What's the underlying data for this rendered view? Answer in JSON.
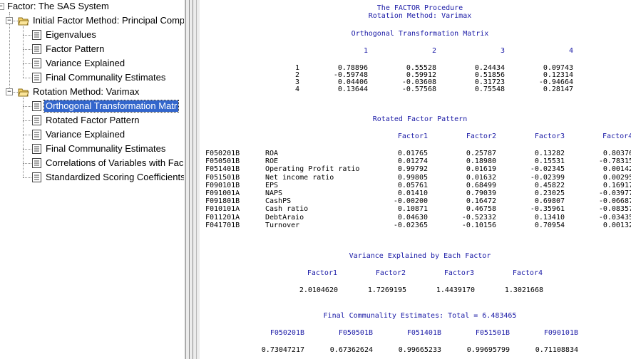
{
  "tree": {
    "root": "Factor:  The SAS System",
    "groups": [
      {
        "label": "Initial Factor Method: Principal Comp",
        "items": [
          "Eigenvalues",
          "Factor Pattern",
          "Variance Explained",
          "Final Communality Estimates"
        ]
      },
      {
        "label": "Rotation Method: Varimax",
        "items": [
          "Orthogonal Transformation Matr",
          "Rotated Factor Pattern",
          "Variance Explained",
          "Final Communality Estimates",
          "Correlations of Variables with Fac",
          "Standardized Scoring Coefficients"
        ]
      }
    ],
    "selected": "Orthogonal Transformation Matr"
  },
  "output": {
    "title1": "The FACTOR Procedure",
    "title2": "Rotation Method: Varimax",
    "otm": {
      "title": "Orthogonal Transformation Matrix",
      "headers": [
        "1",
        "2",
        "3",
        "4"
      ],
      "rows": [
        {
          "label": "1",
          "values": [
            "0.78896",
            "0.55528",
            "0.24434",
            "0.09743"
          ]
        },
        {
          "label": "2",
          "values": [
            "-0.59748",
            "0.59912",
            "0.51856",
            "0.12314"
          ]
        },
        {
          "label": "3",
          "values": [
            "0.04406",
            "-0.03608",
            "0.31723",
            "-0.94664"
          ]
        },
        {
          "label": "4",
          "values": [
            "0.13644",
            "-0.57568",
            "0.75548",
            "0.28147"
          ]
        }
      ]
    },
    "rfp": {
      "title": "Rotated Factor Pattern",
      "headers": [
        "Factor1",
        "Factor2",
        "Factor3",
        "Factor4"
      ],
      "rows": [
        {
          "code": "F050201B",
          "name": "ROA",
          "values": [
            "0.01765",
            "0.25787",
            "0.13282",
            "0.80376"
          ]
        },
        {
          "code": "F050501B",
          "name": "ROE",
          "values": [
            "0.01274",
            "0.18980",
            "0.15531",
            "-0.78315"
          ]
        },
        {
          "code": "F051401B",
          "name": "Operating Profit ratio",
          "values": [
            "0.99792",
            "0.01619",
            "-0.02345",
            "0.00142"
          ]
        },
        {
          "code": "F051501B",
          "name": "Net income ratio",
          "values": [
            "0.99805",
            "0.01632",
            "-0.02399",
            "0.00295"
          ]
        },
        {
          "code": "F090101B",
          "name": "EPS",
          "values": [
            "0.05761",
            "0.68499",
            "0.45822",
            "0.16917"
          ]
        },
        {
          "code": "F091001A",
          "name": "NAPS",
          "values": [
            "0.01410",
            "0.79039",
            "0.23025",
            "-0.03977"
          ]
        },
        {
          "code": "F091801B",
          "name": "CashPS",
          "values": [
            "-0.00200",
            "0.16472",
            "0.69807",
            "-0.06687"
          ]
        },
        {
          "code": "F010101A",
          "name": "Cash ratio",
          "values": [
            "0.10871",
            "0.46758",
            "-0.35961",
            "-0.08357"
          ]
        },
        {
          "code": "F011201A",
          "name": "DebtAraio",
          "values": [
            "0.04630",
            "-0.52332",
            "0.13410",
            "-0.03435"
          ]
        },
        {
          "code": "F041701B",
          "name": "Turnover",
          "values": [
            "-0.02365",
            "-0.10156",
            "0.70954",
            "0.00132"
          ]
        }
      ]
    },
    "var": {
      "title": "Variance Explained by Each Factor",
      "headers": [
        "Factor1",
        "Factor2",
        "Factor3",
        "Factor4"
      ],
      "values": [
        "2.0104620",
        "1.7269195",
        "1.4439170",
        "1.3021668"
      ]
    },
    "comm": {
      "title": "Final Communality Estimates: Total = 6.483465",
      "headers": [
        "F050201B",
        "F050501B",
        "F051401B",
        "F051501B",
        "F090101B"
      ],
      "values": [
        "0.73047217",
        "0.67362624",
        "0.99665233",
        "0.99695799",
        "0.71108834"
      ]
    }
  }
}
